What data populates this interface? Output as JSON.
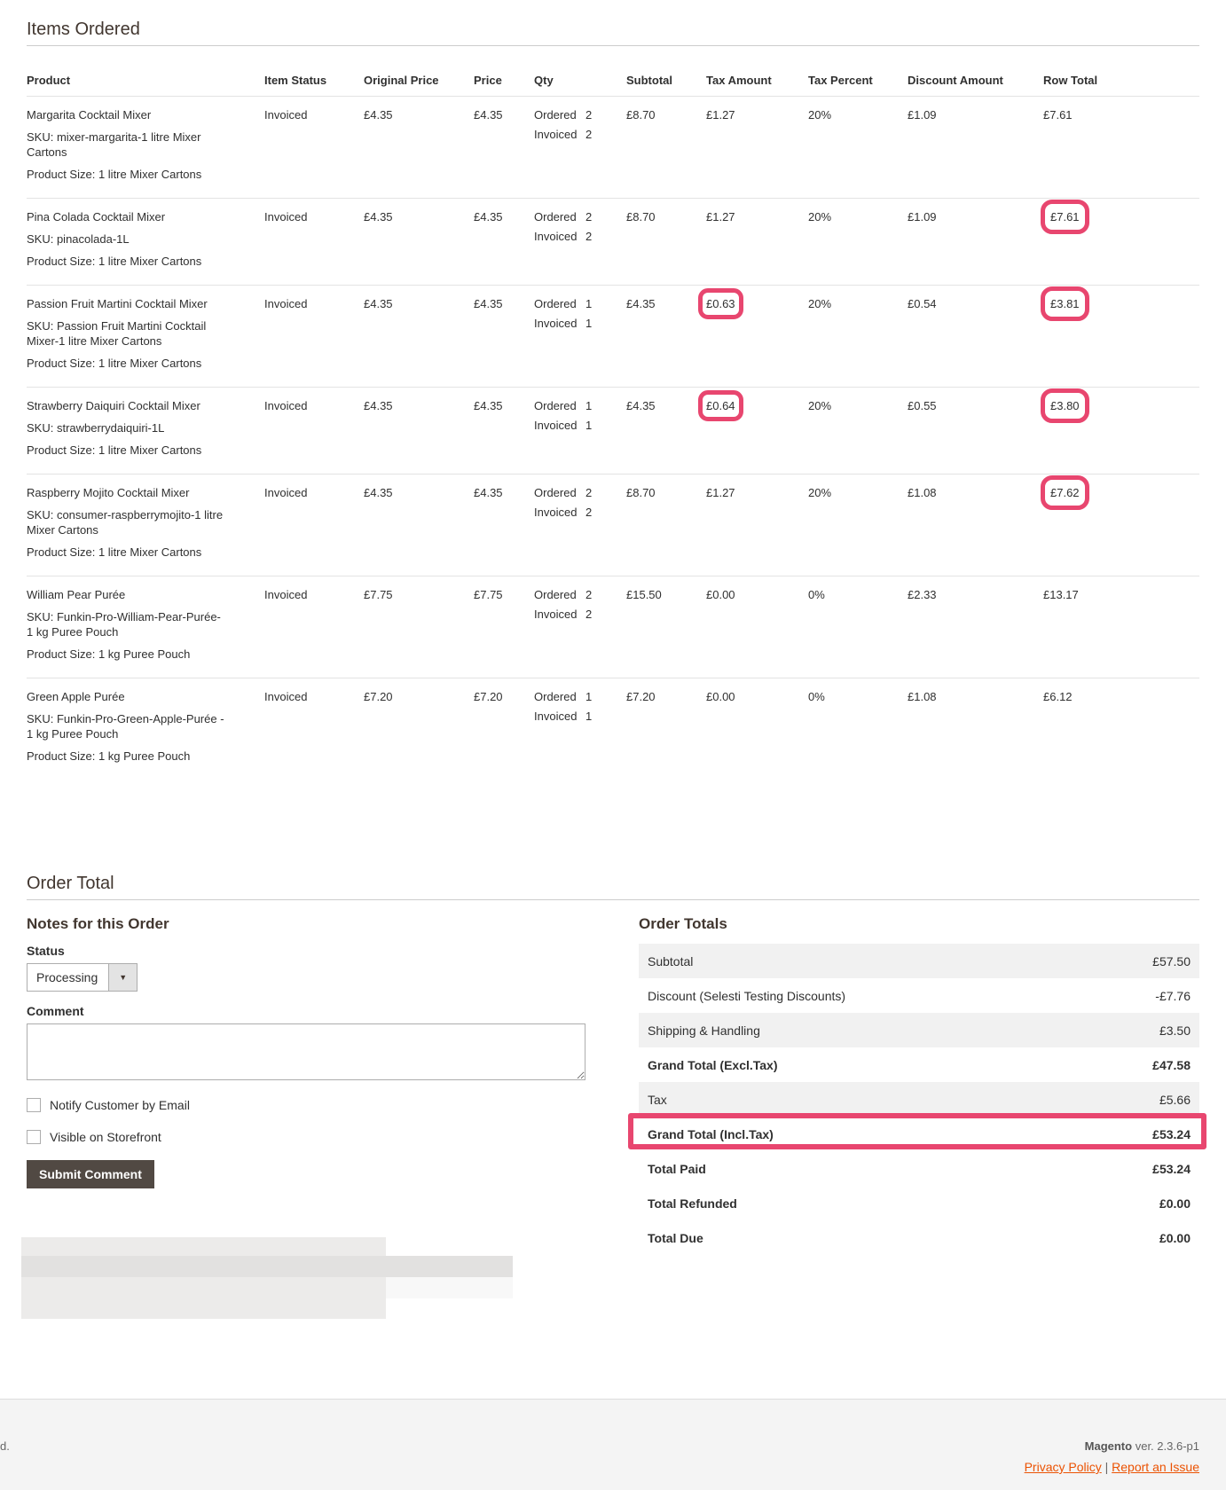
{
  "items_section": {
    "title": "Items Ordered",
    "columns": [
      "Product",
      "Item Status",
      "Original Price",
      "Price",
      "Qty",
      "Subtotal",
      "Tax Amount",
      "Tax Percent",
      "Discount Amount",
      "Row Total"
    ],
    "rows": [
      {
        "name": "Margarita Cocktail Mixer",
        "sku": "SKU: mixer-margarita-1 litre Mixer Cartons",
        "size_label": "Product Size:",
        "size": "1 litre Mixer Cartons",
        "status": "Invoiced",
        "original_price": "£4.35",
        "price": "£4.35",
        "qty_ordered_label": "Ordered",
        "qty_ordered": "2",
        "qty_invoiced_label": "Invoiced",
        "qty_invoiced": "2",
        "subtotal": "£8.70",
        "tax_amount": "£1.27",
        "tax_percent": "20%",
        "discount": "£1.09",
        "row_total": "£7.61",
        "highlight_tax": false,
        "highlight_total": false
      },
      {
        "name": "Pina Colada Cocktail Mixer",
        "sku": "SKU: pinacolada-1L",
        "size_label": "Product Size:",
        "size": "1 litre Mixer Cartons",
        "status": "Invoiced",
        "original_price": "£4.35",
        "price": "£4.35",
        "qty_ordered_label": "Ordered",
        "qty_ordered": "2",
        "qty_invoiced_label": "Invoiced",
        "qty_invoiced": "2",
        "subtotal": "£8.70",
        "tax_amount": "£1.27",
        "tax_percent": "20%",
        "discount": "£1.09",
        "row_total": "£7.61",
        "highlight_tax": false,
        "highlight_total": true
      },
      {
        "name": "Passion Fruit Martini Cocktail Mixer",
        "sku": "SKU: Passion Fruit Martini Cocktail Mixer-1 litre Mixer Cartons",
        "size_label": "Product Size:",
        "size": "1 litre Mixer Cartons",
        "status": "Invoiced",
        "original_price": "£4.35",
        "price": "£4.35",
        "qty_ordered_label": "Ordered",
        "qty_ordered": "1",
        "qty_invoiced_label": "Invoiced",
        "qty_invoiced": "1",
        "subtotal": "£4.35",
        "tax_amount": "£0.63",
        "tax_percent": "20%",
        "discount": "£0.54",
        "row_total": "£3.81",
        "highlight_tax": true,
        "highlight_total": true
      },
      {
        "name": "Strawberry Daiquiri Cocktail Mixer",
        "sku": "SKU: strawberrydaiquiri-1L",
        "size_label": "Product Size:",
        "size": "1 litre Mixer Cartons",
        "status": "Invoiced",
        "original_price": "£4.35",
        "price": "£4.35",
        "qty_ordered_label": "Ordered",
        "qty_ordered": "1",
        "qty_invoiced_label": "Invoiced",
        "qty_invoiced": "1",
        "subtotal": "£4.35",
        "tax_amount": "£0.64",
        "tax_percent": "20%",
        "discount": "£0.55",
        "row_total": "£3.80",
        "highlight_tax": true,
        "highlight_total": true
      },
      {
        "name": "Raspberry Mojito Cocktail Mixer",
        "sku": "SKU: consumer-raspberrymojito-1 litre Mixer Cartons",
        "size_label": "Product Size:",
        "size": "1 litre Mixer Cartons",
        "status": "Invoiced",
        "original_price": "£4.35",
        "price": "£4.35",
        "qty_ordered_label": "Ordered",
        "qty_ordered": "2",
        "qty_invoiced_label": "Invoiced",
        "qty_invoiced": "2",
        "subtotal": "£8.70",
        "tax_amount": "£1.27",
        "tax_percent": "20%",
        "discount": "£1.08",
        "row_total": "£7.62",
        "highlight_tax": false,
        "highlight_total": true
      },
      {
        "name": "William Pear Purée",
        "sku": "SKU: Funkin-Pro-William-Pear-Purée-1 kg Puree Pouch",
        "size_label": "Product Size:",
        "size": "1 kg Puree Pouch",
        "status": "Invoiced",
        "original_price": "£7.75",
        "price": "£7.75",
        "qty_ordered_label": "Ordered",
        "qty_ordered": "2",
        "qty_invoiced_label": "Invoiced",
        "qty_invoiced": "2",
        "subtotal": "£15.50",
        "tax_amount": "£0.00",
        "tax_percent": "0%",
        "discount": "£2.33",
        "row_total": "£13.17",
        "highlight_tax": false,
        "highlight_total": false
      },
      {
        "name": "Green Apple Purée",
        "sku": "SKU: Funkin-Pro-Green-Apple-Purée - 1 kg Puree Pouch",
        "size_label": "Product Size:",
        "size": "1 kg Puree Pouch",
        "status": "Invoiced",
        "original_price": "£7.20",
        "price": "£7.20",
        "qty_ordered_label": "Ordered",
        "qty_ordered": "1",
        "qty_invoiced_label": "Invoiced",
        "qty_invoiced": "1",
        "subtotal": "£7.20",
        "tax_amount": "£0.00",
        "tax_percent": "0%",
        "discount": "£1.08",
        "row_total": "£6.12",
        "highlight_tax": false,
        "highlight_total": false
      }
    ]
  },
  "order_total_section": {
    "title": "Order Total",
    "notes": {
      "title": "Notes for this Order",
      "status_label": "Status",
      "status_value": "Processing",
      "comment_label": "Comment",
      "comment_value": "",
      "notify_label": "Notify Customer by Email",
      "visible_label": "Visible on Storefront",
      "submit_label": "Submit Comment"
    },
    "totals": {
      "title": "Order Totals",
      "rows": [
        {
          "label": "Subtotal",
          "value": "£57.50",
          "bold": false,
          "shaded": true,
          "highlight": false
        },
        {
          "label": "Discount (Selesti Testing Discounts)",
          "value": "-£7.76",
          "bold": false,
          "shaded": false,
          "highlight": false
        },
        {
          "label": "Shipping & Handling",
          "value": "£3.50",
          "bold": false,
          "shaded": true,
          "highlight": false
        },
        {
          "label": "Grand Total (Excl.Tax)",
          "value": "£47.58",
          "bold": true,
          "shaded": false,
          "highlight": false
        },
        {
          "label": "Tax",
          "value": "£5.66",
          "bold": false,
          "shaded": true,
          "highlight": false
        },
        {
          "label": "Grand Total (Incl.Tax)",
          "value": "£53.24",
          "bold": true,
          "shaded": false,
          "highlight": true
        },
        {
          "label": "Total Paid",
          "value": "£53.24",
          "bold": true,
          "shaded": false,
          "highlight": false
        },
        {
          "label": "Total Refunded",
          "value": "£0.00",
          "bold": true,
          "shaded": false,
          "highlight": false
        },
        {
          "label": "Total Due",
          "value": "£0.00",
          "bold": true,
          "shaded": false,
          "highlight": false
        }
      ]
    }
  },
  "footer": {
    "left_fragment": "d.",
    "brand": "Magento",
    "version": "ver. 2.3.6-p1",
    "privacy_link": "Privacy Policy",
    "separator": "|",
    "report_link": "Report an Issue"
  },
  "colors": {
    "highlight": "#e8466f",
    "button_bg": "#514943",
    "link": "#eb5202"
  }
}
